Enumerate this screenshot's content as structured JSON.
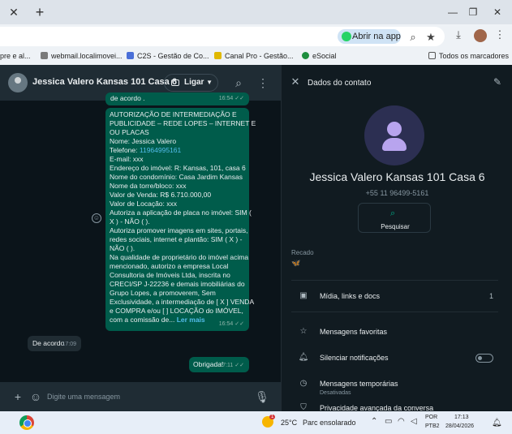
{
  "browser": {
    "tab_close": "✕",
    "new_tab": "+",
    "window_controls": [
      "—",
      "❐",
      "✕"
    ],
    "open_app_label": "Abrir na app",
    "bookmarks": [
      {
        "label": "pre e al...",
        "color": "#c0c0c0"
      },
      {
        "label": "webmail.localimovei...",
        "color": "#7a7a7a"
      },
      {
        "label": "C2S - Gestão de Co...",
        "color": "#4a6fd8"
      },
      {
        "label": "Canal Pro - Gestão...",
        "color": "#e0b800"
      },
      {
        "label": "eSocial",
        "color": "#1e8e3e"
      }
    ],
    "all_bookmarks_label": "Todos os marcadores"
  },
  "chat": {
    "contact_name": "Jessica Valero Kansas 101 Casa 6",
    "call_label": "Ligar",
    "top_bubble_text": "de acordo .",
    "top_bubble_time": "16:54",
    "main_message": {
      "lines_before_phone": [
        "AUTORIZAÇÃO DE INTERMEDIAÇÃO E",
        "PUBLICIDADE – REDE LOPES – INTERNET E",
        "OU PLACAS",
        "Nome: Jessica Valero"
      ],
      "phone_prefix": "Telefone: ",
      "phone": "11964995161",
      "lines_after_phone": [
        "E-mail:  xxx",
        "Endereço do imóvel: R: Kansas, 101, casa 6",
        "Nome do condomínio:  Casa Jardim Kansas",
        "Nome da torre/bloco: xxx",
        "Valor de Venda:  R$ 6.710.000,00",
        "Valor de Locação: xxx",
        "Autoriza a aplicação de placa no imóvel: SIM (",
        "X ) - NÃO (    ).",
        "Autoriza promover imagens em sites, portais,",
        "redes sociais, internet e plantão: SIM ( X ) -",
        "NÃO (    ).",
        "Na qualidade de proprietário do imóvel acima",
        "mencionado, autorizo a empresa Local",
        "Consultoria de Imóveis Ltda, inscrita no",
        "CRECI/SP J-22236 e demais imobiliárias do",
        "Grupo Lopes, a promoverem, Sem",
        "Exclusividade, a intermediação de [   X ] VENDA",
        "e COMPRA e/ou [   ] LOCAÇÃO do IMÓVEL,"
      ],
      "last_line": "com a comissão de...",
      "read_more": "Ler mais",
      "time": "16:54"
    },
    "incoming": {
      "text": "De acordo",
      "time": "17:09"
    },
    "outgoing": {
      "text": "Obrigada!",
      "time": "17:11"
    },
    "composer_placeholder": "Digite uma mensagem"
  },
  "info": {
    "title": "Dados do contato",
    "name": "Jessica Valero Kansas 101 Casa 6",
    "phone": "+55 11 96499-5161",
    "search_label": "Pesquisar",
    "recado_label": "Recado",
    "recado_value": "🦋",
    "rows": [
      {
        "label": "Mídia, links e docs",
        "count": "1"
      },
      {
        "label": "Mensagens favoritas"
      },
      {
        "label": "Silenciar notificações"
      },
      {
        "label": "Mensagens temporárias",
        "sub": "Desativadas"
      },
      {
        "label": "Privacidade avançada da conversa"
      }
    ]
  },
  "taskbar": {
    "weather_badge": "1",
    "temperature": "25°C",
    "condition": "Parc ensolarado",
    "lang1": "POR",
    "lang2": "PTB2",
    "time": "17:13",
    "date": "28/04/2026"
  },
  "colors": {
    "outgoing_bubble": "#005c4b",
    "incoming_bubble": "#202c33",
    "accent": "#00a884",
    "link": "#53bdeb"
  }
}
